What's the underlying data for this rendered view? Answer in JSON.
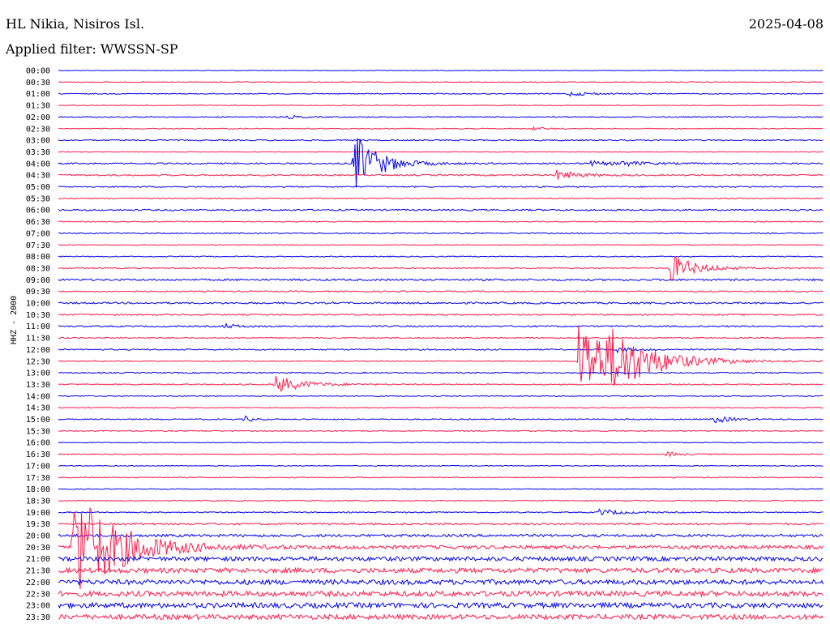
{
  "header": {
    "station": "HL Nikia, Nisiros Isl.",
    "date": "2025-04-08",
    "filter": "Applied filter: WWSSN-SP",
    "channel": "HHZ - 2000"
  },
  "colors": {
    "even_trace": "#0000ee",
    "odd_trace": "#ff1a4a"
  },
  "chart_data": {
    "type": "line",
    "title": "HL Nikia, Nisiros Isl.",
    "subtitle": "Applied filter: WWSSN-SP",
    "ylabel": "HHZ - 2000",
    "row_labels": [
      "00:00",
      "00:30",
      "01:00",
      "01:30",
      "02:00",
      "02:30",
      "03:00",
      "03:30",
      "04:00",
      "04:30",
      "05:00",
      "05:30",
      "06:00",
      "06:30",
      "07:00",
      "07:30",
      "08:00",
      "08:30",
      "09:00",
      "09:30",
      "10:00",
      "10:30",
      "11:00",
      "11:30",
      "12:00",
      "12:30",
      "13:00",
      "13:30",
      "14:00",
      "14:30",
      "15:00",
      "15:30",
      "16:00",
      "16:30",
      "17:00",
      "17:30",
      "18:00",
      "18:30",
      "19:00",
      "19:30",
      "20:00",
      "20:30",
      "21:00",
      "21:30",
      "22:00",
      "22:30",
      "23:00",
      "23:30"
    ],
    "row_minutes": 30,
    "noise_level": [
      0.4,
      0.5,
      0.6,
      0.5,
      0.7,
      0.6,
      0.8,
      0.5,
      0.9,
      0.9,
      0.8,
      0.7,
      1.0,
      0.6,
      0.7,
      0.5,
      0.6,
      0.7,
      1.2,
      0.8,
      1.1,
      0.9,
      0.9,
      0.7,
      0.8,
      0.6,
      0.8,
      0.7,
      0.6,
      0.6,
      0.7,
      0.6,
      0.5,
      0.6,
      0.5,
      0.6,
      0.5,
      0.6,
      0.7,
      1.2,
      1.6,
      2.2,
      2.6,
      3.0,
      3.0,
      3.2,
      3.2,
      3.0
    ],
    "events": [
      {
        "row": 2,
        "minute": 20.0,
        "amp": 3,
        "dur": 0.8
      },
      {
        "row": 4,
        "minute": 9.0,
        "amp": 2,
        "dur": 0.5
      },
      {
        "row": 5,
        "minute": 18.5,
        "amp": 2,
        "dur": 0.5
      },
      {
        "row": 8,
        "minute": 11.6,
        "amp": 38,
        "dur": 0.9
      },
      {
        "row": 8,
        "minute": 20.8,
        "amp": 3,
        "dur": 0.8
      },
      {
        "row": 8,
        "minute": 22.0,
        "amp": 3,
        "dur": 0.9
      },
      {
        "row": 9,
        "minute": 19.5,
        "amp": 6,
        "dur": 0.8
      },
      {
        "row": 17,
        "minute": 24.0,
        "amp": 18,
        "dur": 0.9
      },
      {
        "row": 22,
        "minute": 6.5,
        "amp": 3,
        "dur": 0.5
      },
      {
        "row": 25,
        "minute": 20.4,
        "amp": 50,
        "dur": 1.8
      },
      {
        "row": 25,
        "minute": 21.6,
        "amp": 22,
        "dur": 1.2
      },
      {
        "row": 24,
        "minute": 21.9,
        "amp": 3,
        "dur": 0.6
      },
      {
        "row": 27,
        "minute": 8.5,
        "amp": 11,
        "dur": 1.0
      },
      {
        "row": 30,
        "minute": 7.3,
        "amp": 4,
        "dur": 0.3
      },
      {
        "row": 30,
        "minute": 25.7,
        "amp": 5,
        "dur": 0.6
      },
      {
        "row": 33,
        "minute": 23.8,
        "amp": 3,
        "dur": 0.6
      },
      {
        "row": 38,
        "minute": 21.2,
        "amp": 4,
        "dur": 0.8
      },
      {
        "row": 41,
        "minute": 0.6,
        "amp": 75,
        "dur": 1.6
      }
    ]
  }
}
